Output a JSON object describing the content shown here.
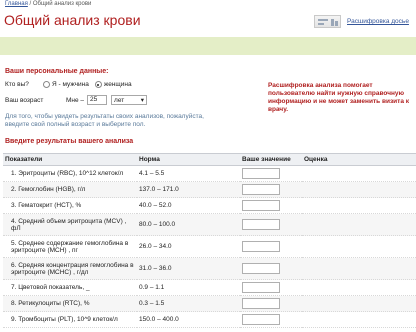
{
  "breadcrumb": {
    "home": "Главная",
    "separator": "/",
    "current": "Общий анализ крови"
  },
  "page_title": "Общий анализ крови",
  "header_link": "Расшифровка досье",
  "personal": {
    "heading": "Ваши персональные данные:",
    "who_label": "Кто вы?",
    "male_label": "Я - мужчина",
    "female_label": "женщина",
    "selected": "female",
    "age_label": "Ваш возраст",
    "age_prefix": "Мне –",
    "age_value": "25",
    "age_unit": "лет"
  },
  "hint": "Для того, чтобы увидеть результаты своих анализов, пожалуйста, введите свой полный возраст и выберите пол.",
  "side_note": "Расшифровка анализа помогает пользователю найти нужную справочную информацию и не может заменить визита к врачу.",
  "results": {
    "heading": "Введите результаты вашего анализа",
    "columns": [
      "Показатели",
      "Норма",
      "Ваше значение",
      "Оценка"
    ],
    "rows": [
      {
        "name": "1. Эритроциты (RBC), 10^12 клеток/л",
        "norm": "4.1 – 5.5"
      },
      {
        "name": "2. Гемоглобин (HGB), г/л",
        "norm": "137.0 – 171.0"
      },
      {
        "name": "3. Гематокрит (HCT), %",
        "norm": "40.0 – 52.0"
      },
      {
        "name": "4. Средний объем эритроцита (MCV) , фЛ",
        "norm": "80.0 – 100.0"
      },
      {
        "name": "5. Среднее содержание гемоглобина в эритроците (MCH) , пг",
        "norm": "26.0 – 34.0"
      },
      {
        "name": "6. Средняя концентрация гемоглобина в эритроците (MCHC) , г/дл",
        "norm": "31.0 – 36.0"
      },
      {
        "name": "7. Цветовой показатель, _",
        "norm": "0.9 – 1.1"
      },
      {
        "name": "8. Ретикулоциты (RTC), %",
        "norm": "0.3 – 1.5"
      },
      {
        "name": "9. Тромбоциты (PLT), 10^9 клеток/л",
        "norm": "150.0 – 400.0"
      }
    ]
  }
}
